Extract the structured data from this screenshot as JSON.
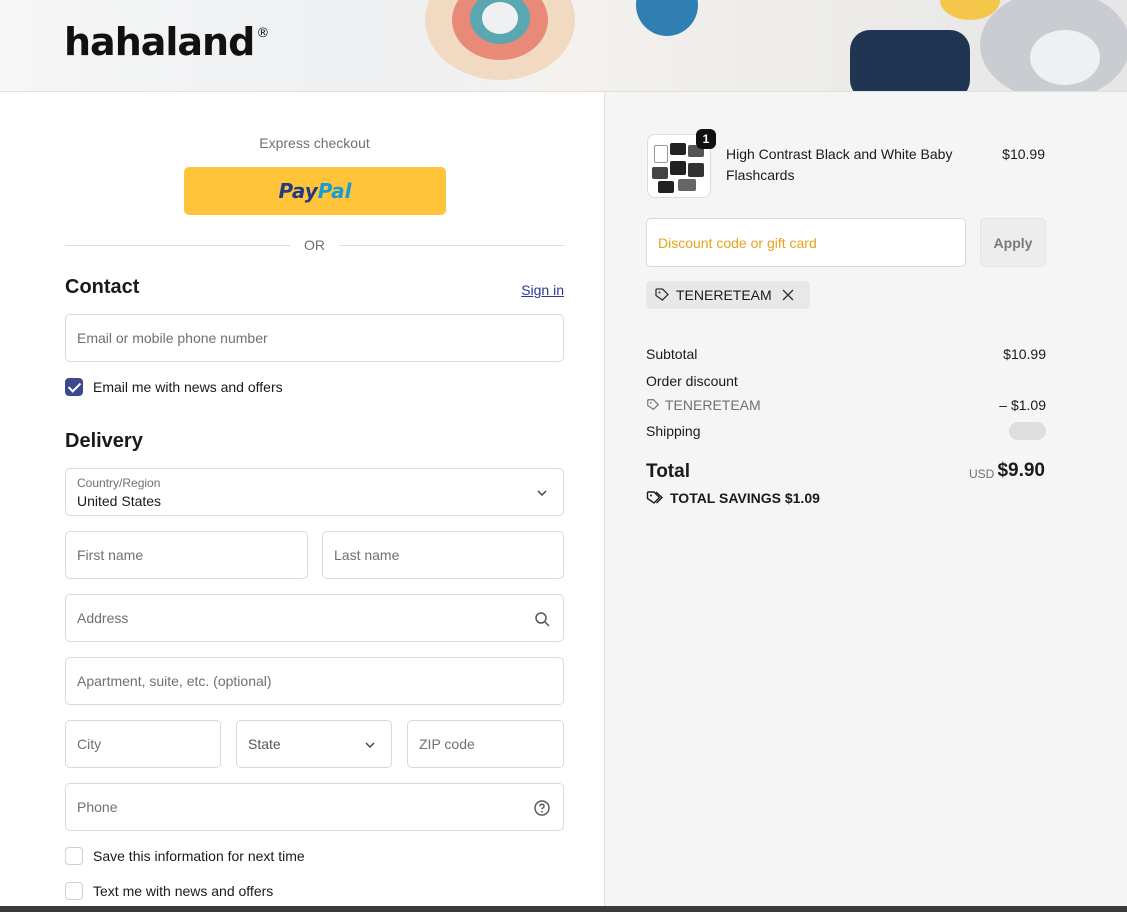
{
  "header": {
    "logo": "hahaland",
    "logo_mark": "®"
  },
  "express": {
    "label": "Express checkout",
    "paypal_a": "Pay",
    "paypal_b": "Pal",
    "or": "OR"
  },
  "contact": {
    "title": "Contact",
    "signin": "Sign in",
    "email_placeholder": "Email or mobile phone number",
    "news_label": "Email me with news and offers",
    "news_checked": true
  },
  "delivery": {
    "title": "Delivery",
    "country_label": "Country/Region",
    "country_value": "United States",
    "first_name": "First name",
    "last_name": "Last name",
    "address": "Address",
    "apartment": "Apartment, suite, etc. (optional)",
    "city": "City",
    "state": "State",
    "zip": "ZIP code",
    "phone": "Phone",
    "save_info": "Save this information for next time",
    "text_me": "Text me with news and offers"
  },
  "summary": {
    "product_name": "High Contrast Black and White Baby Flashcards",
    "product_price": "$10.99",
    "quantity": "1",
    "discount_placeholder": "Discount code or gift card",
    "apply": "Apply",
    "applied_code": "TENERETEAM",
    "subtotal_label": "Subtotal",
    "subtotal_value": "$10.99",
    "order_discount_label": "Order discount",
    "discount_code": "TENERETEAM",
    "discount_value": "– $1.09",
    "shipping_label": "Shipping",
    "total_label": "Total",
    "currency": "USD",
    "total_value": "$9.90",
    "savings": "TOTAL SAVINGS  $1.09"
  },
  "colors": {
    "accent": "#3b4a8c",
    "paypal": "#ffc439",
    "discount_placeholder": "#e8a21b"
  }
}
